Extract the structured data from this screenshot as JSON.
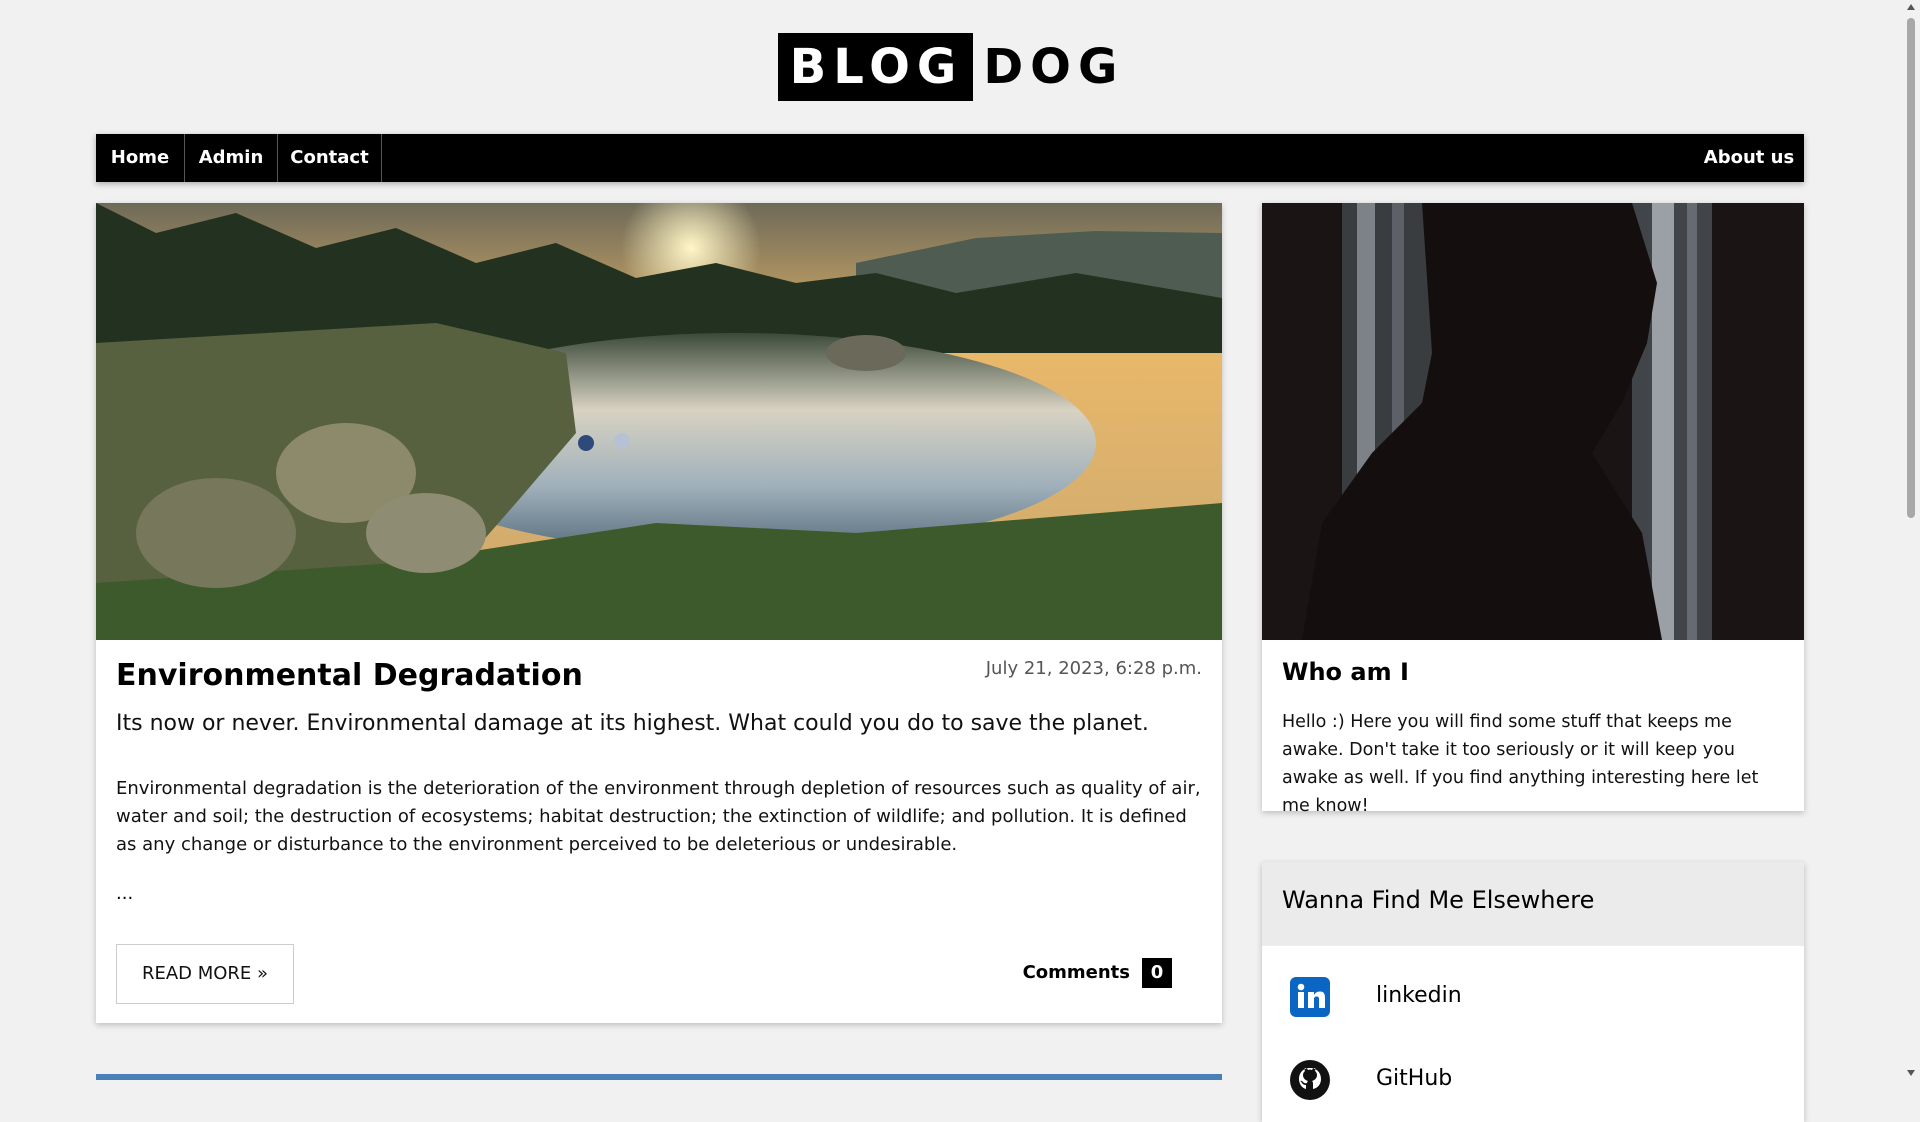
{
  "site": {
    "logo_boxed": "BLOG",
    "logo_plain": "DOG"
  },
  "nav": {
    "items": [
      {
        "label": "Home"
      },
      {
        "label": "Admin"
      },
      {
        "label": "Contact"
      }
    ],
    "right_label": "About us"
  },
  "post": {
    "image_icon": "landscape-lake-sunset-photo",
    "title": "Environmental Degradation",
    "date": "July 21, 2023, 6:28 p.m.",
    "subtitle": "Its now or never. Environmental damage at its highest. What could you do to save the planet.",
    "body": "Environmental degradation is the deterioration of the environment through depletion of resources such as quality of air, water and soil; the destruction of ecosystems; habitat destruction; the extinction of wildlife; and pollution. It is defined as any change or disturbance to the environment perceived to be deleterious or undesirable.",
    "ellipsis": "...",
    "read_more": "READ MORE »",
    "comments_label": "Comments",
    "comments_count": "0"
  },
  "about": {
    "image_icon": "silhouette-window-photo",
    "title": "Who am I",
    "text": "Hello :) Here you will find some stuff that keeps me awake. Don't take it too seriously or it will keep you awake as well. If you find anything interesting here let me know!"
  },
  "elsewhere": {
    "title": "Wanna Find Me Elsewhere",
    "links": [
      {
        "label": "linkedin",
        "icon": "linkedin-icon"
      },
      {
        "label": "GitHub",
        "icon": "github-icon"
      }
    ]
  },
  "colors": {
    "background": "#f1f1f1",
    "nav": "#000000",
    "linkedin": "#0a66c2"
  }
}
